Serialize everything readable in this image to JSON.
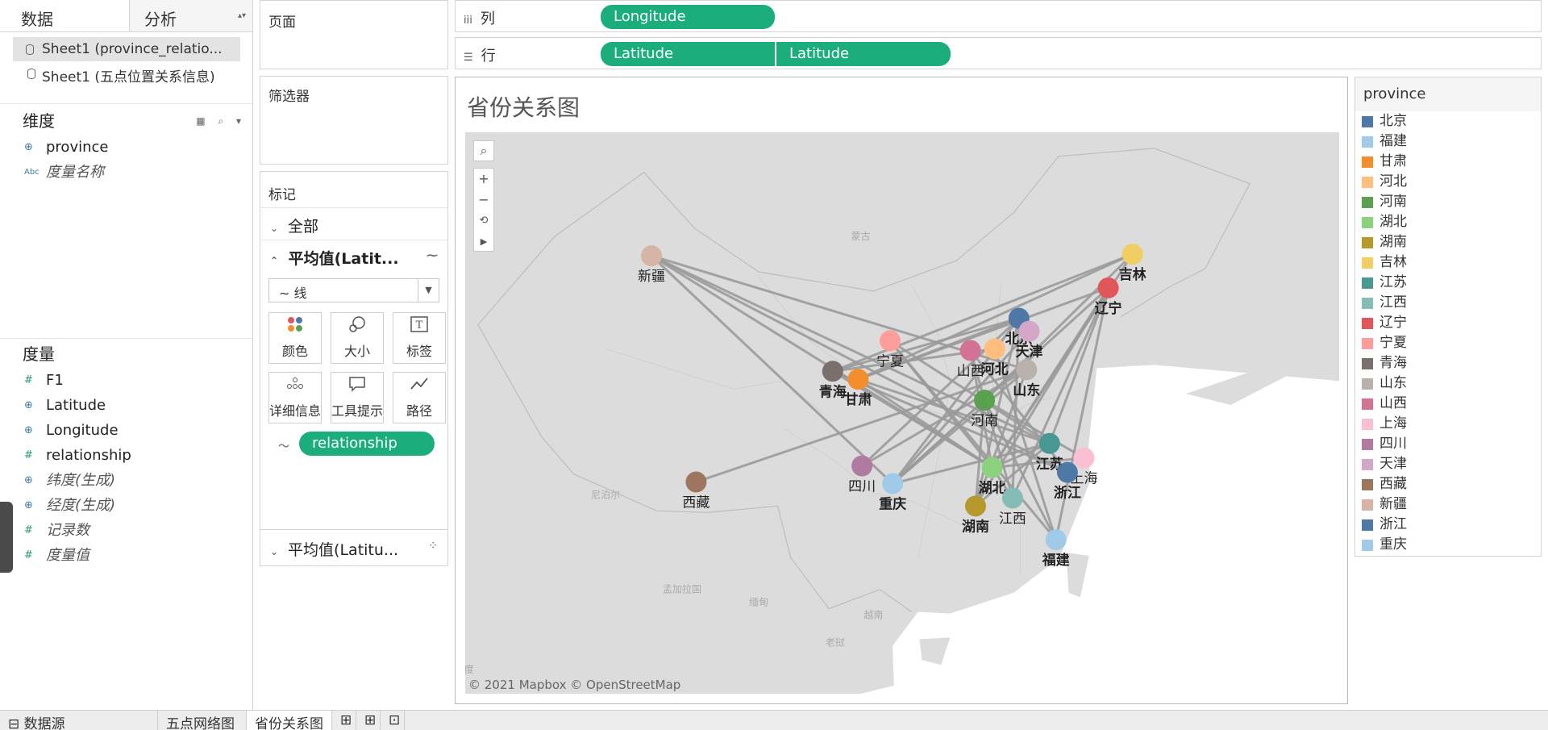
{
  "left_pane": {
    "tabs": [
      "数据",
      "分析"
    ],
    "datasources": [
      "Sheet1 (province_relatio...",
      "Sheet1 (五点位置关系信息)"
    ],
    "dimensions_title": "维度",
    "dimensions": [
      {
        "label": "province",
        "italic": false,
        "icon": "globe-icon"
      },
      {
        "label": "度量名称",
        "italic": true,
        "icon": "abc-icon"
      }
    ],
    "measures_title": "度量",
    "measures": [
      {
        "label": "F1",
        "italic": false,
        "icon": "hash-icon"
      },
      {
        "label": "Latitude",
        "italic": false,
        "icon": "globe-icon"
      },
      {
        "label": "Longitude",
        "italic": false,
        "icon": "globe-icon"
      },
      {
        "label": "relationship",
        "italic": false,
        "icon": "hash-icon"
      },
      {
        "label": "纬度(生成)",
        "italic": true,
        "icon": "globe-icon"
      },
      {
        "label": "经度(生成)",
        "italic": true,
        "icon": "globe-icon"
      },
      {
        "label": "记录数",
        "italic": true,
        "icon": "hash-icon"
      },
      {
        "label": "度量值",
        "italic": true,
        "icon": "hash-icon"
      }
    ]
  },
  "cards": {
    "pages": "页面",
    "filters": "筛选器",
    "marks": "标记",
    "all": "全部",
    "avg1": "平均值(Latit...",
    "avg2": "平均值(Latitu...",
    "mark_type": "线",
    "mark_buttons": [
      "颜色",
      "大小",
      "标签",
      "详细信息",
      "工具提示",
      "路径"
    ],
    "relationship_pill": "relationship"
  },
  "shelves": {
    "columns_label": "列",
    "rows_label": "行",
    "columns_pills": [
      "Longitude"
    ],
    "rows_pills": [
      "Latitude",
      "Latitude"
    ]
  },
  "sheet": {
    "title": "省份关系图",
    "attribution": "© 2021 Mapbox © OpenStreetMap",
    "basemap_labels": [
      "蒙古",
      "尼泊尔",
      "孟加拉国",
      "缅甸",
      "越南",
      "老挝",
      "度"
    ]
  },
  "legend": {
    "title": "province",
    "items": [
      {
        "name": "北京",
        "color": "#4e79a7"
      },
      {
        "name": "福建",
        "color": "#a0cbe8"
      },
      {
        "name": "甘肃",
        "color": "#f28e2b"
      },
      {
        "name": "河北",
        "color": "#ffbe7d"
      },
      {
        "name": "河南",
        "color": "#59a14f"
      },
      {
        "name": "湖北",
        "color": "#8cd17d"
      },
      {
        "name": "湖南",
        "color": "#b6992d"
      },
      {
        "name": "吉林",
        "color": "#f1ce63"
      },
      {
        "name": "江苏",
        "color": "#499894"
      },
      {
        "name": "江西",
        "color": "#86bcb6"
      },
      {
        "name": "辽宁",
        "color": "#e15759"
      },
      {
        "name": "宁夏",
        "color": "#ff9d9a"
      },
      {
        "name": "青海",
        "color": "#79706e"
      },
      {
        "name": "山东",
        "color": "#bab0ac"
      },
      {
        "name": "山西",
        "color": "#d37295"
      },
      {
        "name": "上海",
        "color": "#fabfd2"
      },
      {
        "name": "四川",
        "color": "#b07aa1"
      },
      {
        "name": "天津",
        "color": "#d4a6c8"
      },
      {
        "name": "西藏",
        "color": "#9d7660"
      },
      {
        "name": "新疆",
        "color": "#d7b5a6"
      },
      {
        "name": "浙江",
        "color": "#4e79a7"
      },
      {
        "name": "重庆",
        "color": "#a0cbe8"
      }
    ]
  },
  "bottom_tabs": [
    "数据源",
    "五点网络图",
    "省份关系图"
  ],
  "provinces": [
    {
      "name": "新疆",
      "lon": 87.6,
      "lat": 43.8
    },
    {
      "name": "吉林",
      "lon": 125.3,
      "lat": 43.9
    },
    {
      "name": "辽宁",
      "lon": 123.4,
      "lat": 41.8
    },
    {
      "name": "北京",
      "lon": 116.4,
      "lat": 39.9
    },
    {
      "name": "天津",
      "lon": 117.2,
      "lat": 39.1
    },
    {
      "name": "河北",
      "lon": 114.5,
      "lat": 38.0
    },
    {
      "name": "甘肃",
      "lon": 103.8,
      "lat": 36.1
    },
    {
      "name": "宁夏",
      "lon": 106.3,
      "lat": 38.5
    },
    {
      "name": "山西",
      "lon": 112.6,
      "lat": 37.9
    },
    {
      "name": "青海",
      "lon": 101.8,
      "lat": 36.6
    },
    {
      "name": "山东",
      "lon": 117.0,
      "lat": 36.7
    },
    {
      "name": "河南",
      "lon": 113.7,
      "lat": 34.8
    },
    {
      "name": "江苏",
      "lon": 118.8,
      "lat": 32.1
    },
    {
      "name": "上海",
      "lon": 121.5,
      "lat": 31.2
    },
    {
      "name": "西藏",
      "lon": 91.1,
      "lat": 29.7
    },
    {
      "name": "四川",
      "lon": 104.1,
      "lat": 30.7
    },
    {
      "name": "湖北",
      "lon": 114.3,
      "lat": 30.6
    },
    {
      "name": "重庆",
      "lon": 106.5,
      "lat": 29.6
    },
    {
      "name": "湖南",
      "lon": 113.0,
      "lat": 28.2
    },
    {
      "name": "江西",
      "lon": 115.9,
      "lat": 28.7
    },
    {
      "name": "浙江",
      "lon": 120.2,
      "lat": 30.3
    },
    {
      "name": "福建",
      "lon": 119.3,
      "lat": 26.1
    }
  ],
  "links": [
    [
      "新疆",
      "湖北"
    ],
    [
      "新疆",
      "江苏"
    ],
    [
      "新疆",
      "浙江"
    ],
    [
      "新疆",
      "重庆"
    ],
    [
      "新疆",
      "山东"
    ],
    [
      "吉林",
      "甘肃"
    ],
    [
      "吉林",
      "青海"
    ],
    [
      "吉林",
      "湖北"
    ],
    [
      "吉林",
      "河南"
    ],
    [
      "辽宁",
      "甘肃"
    ],
    [
      "辽宁",
      "湖北"
    ],
    [
      "辽宁",
      "重庆"
    ],
    [
      "辽宁",
      "福建"
    ],
    [
      "辽宁",
      "江西"
    ],
    [
      "辽宁",
      "湖南"
    ],
    [
      "辽宁",
      "江苏"
    ],
    [
      "北京",
      "青海"
    ],
    [
      "北京",
      "湖南"
    ],
    [
      "北京",
      "江西"
    ],
    [
      "北京",
      "重庆"
    ],
    [
      "北京",
      "四川"
    ],
    [
      "河北",
      "福建"
    ],
    [
      "天津",
      "重庆"
    ],
    [
      "甘肃",
      "江苏"
    ],
    [
      "甘肃",
      "湖北"
    ],
    [
      "甘肃",
      "北京"
    ],
    [
      "青海",
      "浙江"
    ],
    [
      "青海",
      "湖北"
    ],
    [
      "青海",
      "河北"
    ],
    [
      "西藏",
      "山东"
    ],
    [
      "宁夏",
      "湖北"
    ],
    [
      "宁夏",
      "江苏"
    ],
    [
      "宁夏",
      "福建"
    ],
    [
      "山西",
      "湖北"
    ],
    [
      "山西",
      "浙江"
    ],
    [
      "山西",
      "江西"
    ],
    [
      "山东",
      "四川"
    ],
    [
      "山东",
      "湖南"
    ],
    [
      "山东",
      "重庆"
    ],
    [
      "河南",
      "上海"
    ],
    [
      "河南",
      "湖南"
    ],
    [
      "河南",
      "福建"
    ],
    [
      "河南",
      "重庆"
    ],
    [
      "江苏",
      "湖北"
    ],
    [
      "江苏",
      "重庆"
    ],
    [
      "江苏",
      "湖南"
    ],
    [
      "湖北",
      "江西"
    ],
    [
      "湖北",
      "上海"
    ]
  ]
}
